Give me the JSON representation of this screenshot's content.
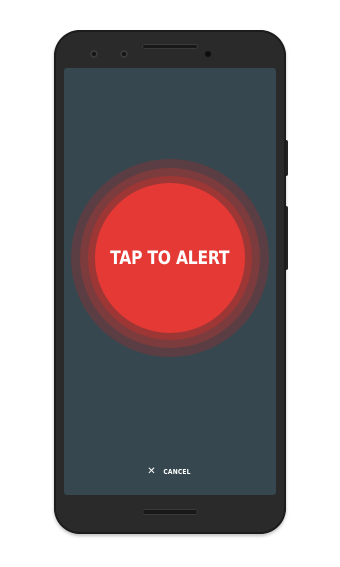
{
  "screen": {
    "alert_button": {
      "label": "TAP TO ALERT",
      "color": "#e53935"
    },
    "cancel": {
      "icon": "close-icon",
      "icon_glyph": "✕",
      "label": "CANCEL"
    },
    "background_color": "#37474f"
  },
  "device": {
    "body_color": "#2a2a2a"
  }
}
